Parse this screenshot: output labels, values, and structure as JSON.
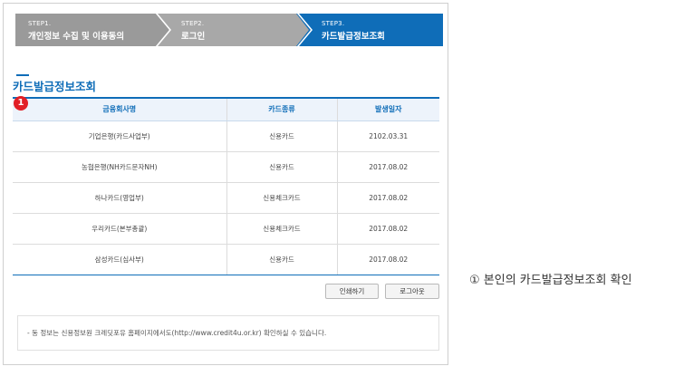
{
  "steps": [
    {
      "num": "STEP1.",
      "label": "개인정보 수집 및 이용동의"
    },
    {
      "num": "STEP2.",
      "label": "로그인"
    },
    {
      "num": "STEP3.",
      "label": "카드발급정보조회"
    }
  ],
  "section_title": "카드발급정보조회",
  "badge": "1",
  "table": {
    "headers": [
      "금융회사명",
      "카드종류",
      "발생일자"
    ],
    "rows": [
      [
        "기업은행(카드사업부)",
        "신용카드",
        "2102.03.31"
      ],
      [
        "농협은행(NH카드문자NH)",
        "신용카드",
        "2017.08.02"
      ],
      [
        "하나카드(영업부)",
        "신용체크카드",
        "2017.08.02"
      ],
      [
        "우리카드(본부총괄)",
        "신용체크카드",
        "2017.08.02"
      ],
      [
        "삼성카드(심사부)",
        "신용카드",
        "2017.08.02"
      ]
    ]
  },
  "buttons": {
    "print": "인쇄하기",
    "logout": "로그아웃"
  },
  "notice": "- 동 정보는 신용정보원 크레딧포유 홈페이지에서도(http://www.credit4u.or.kr) 확인하실 수 있습니다.",
  "annotation": "① 본인의 카드발급정보조회 확인",
  "colors": {
    "accent": "#0f6db8",
    "step_inactive": "#9a9a9a",
    "badge": "#e21f26"
  }
}
